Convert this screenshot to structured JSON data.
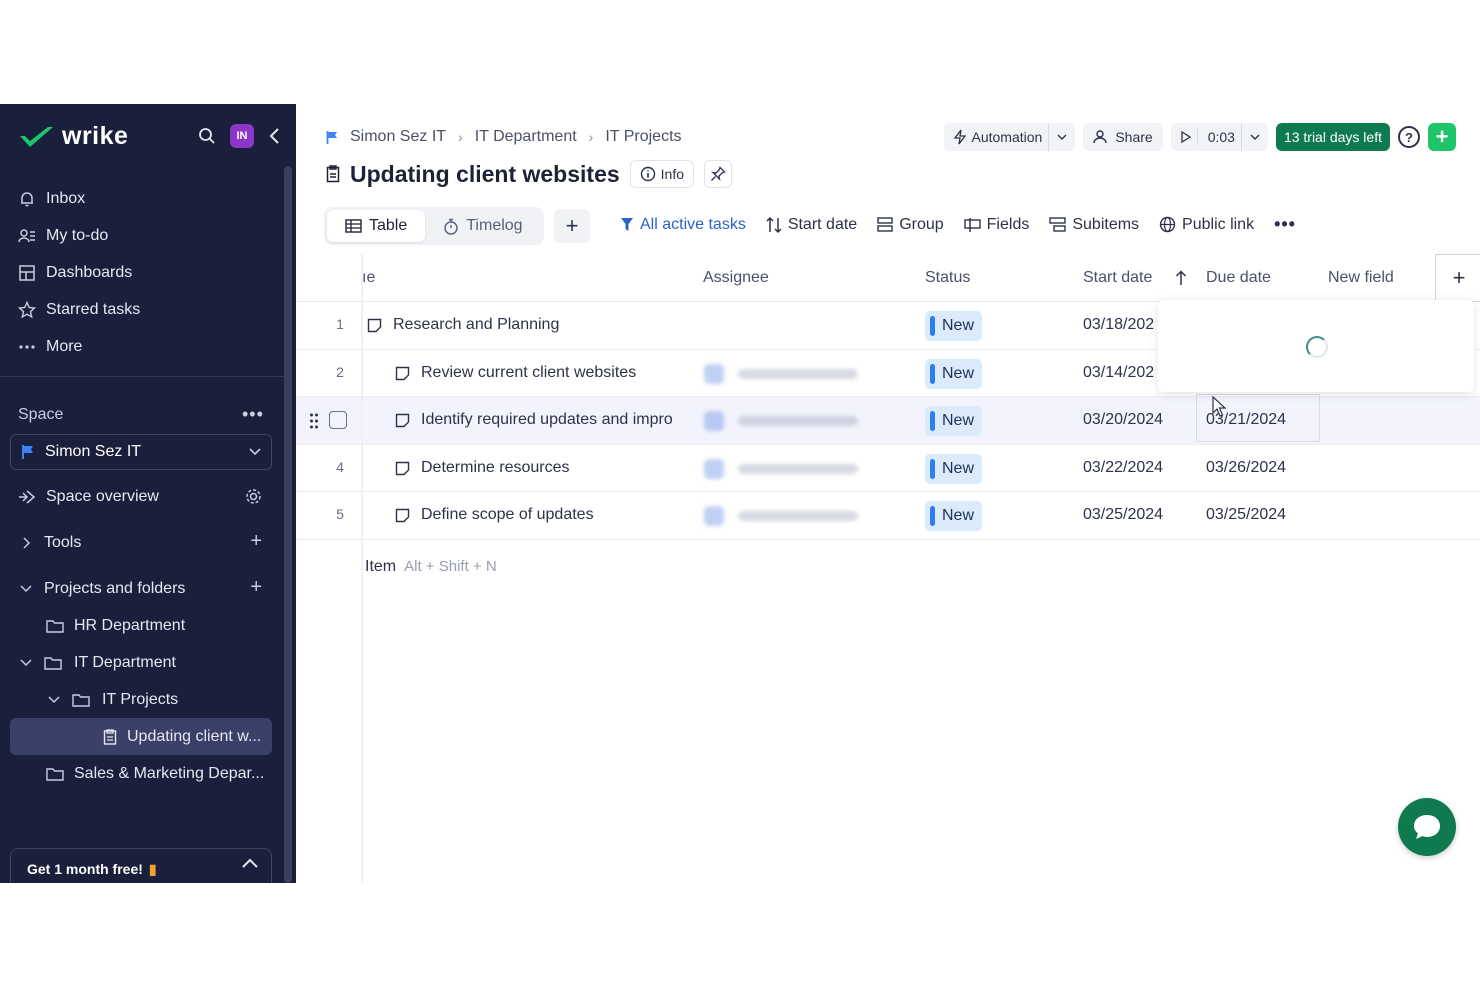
{
  "brand": {
    "logo_text": "wrike",
    "avatar_initials": "IN"
  },
  "sidebar": {
    "nav": [
      {
        "label": "Inbox",
        "icon": "bell-icon"
      },
      {
        "label": "My to-do",
        "icon": "person-list-icon"
      },
      {
        "label": "Dashboards",
        "icon": "dashboard-icon"
      },
      {
        "label": "Starred tasks",
        "icon": "star-icon"
      },
      {
        "label": "More",
        "icon": "dots-icon"
      }
    ],
    "space_label": "Space",
    "space_name": "Simon Sez IT",
    "space_overview": "Space overview",
    "tools": "Tools",
    "projects_and_folders": "Projects and folders",
    "tree": [
      {
        "label": "HR Department"
      },
      {
        "label": "IT Department"
      },
      {
        "label": "IT Projects"
      },
      {
        "label": "Updating client w..."
      },
      {
        "label": "Sales & Marketing Depar..."
      }
    ],
    "promo": "Get 1 month free!"
  },
  "header": {
    "breadcrumb": [
      "Simon Sez IT",
      "IT Department",
      "IT Projects"
    ],
    "automation": "Automation",
    "share": "Share",
    "timer": "0:03",
    "trial": "13 trial days left",
    "title": "Updating client websites",
    "info": "Info"
  },
  "views": {
    "table": "Table",
    "timelog": "Timelog"
  },
  "toolbar": {
    "filter": "All active tasks",
    "sort": "Start date",
    "group": "Group",
    "fields": "Fields",
    "subitems": "Subitems",
    "public_link": "Public link"
  },
  "table": {
    "columns": {
      "name": "ıe",
      "assignee": "Assignee",
      "status": "Status",
      "start": "Start date",
      "due": "Due date",
      "new_field": "New field"
    },
    "rows": [
      {
        "num": "1",
        "name": "Research and Planning",
        "status": "New",
        "start": "03/18/202",
        "due": ""
      },
      {
        "num": "2",
        "name": "Review current client websites",
        "status": "New",
        "start": "03/14/202",
        "due": ""
      },
      {
        "num": "",
        "name": "Identify required updates and impro",
        "status": "New",
        "start": "03/20/2024",
        "due": "03/21/2024"
      },
      {
        "num": "4",
        "name": "Determine resources",
        "status": "New",
        "start": "03/22/2024",
        "due": "03/26/2024"
      },
      {
        "num": "5",
        "name": "Define scope of updates",
        "status": "New",
        "start": "03/25/2024",
        "due": "03/25/2024"
      }
    ],
    "new_item": "Item",
    "new_item_hint": "Alt + Shift + N"
  },
  "colors": {
    "sidebar_bg": "#1a1f3c",
    "accent_green": "#0f7a4f",
    "status_blue": "#2d7ff0"
  }
}
